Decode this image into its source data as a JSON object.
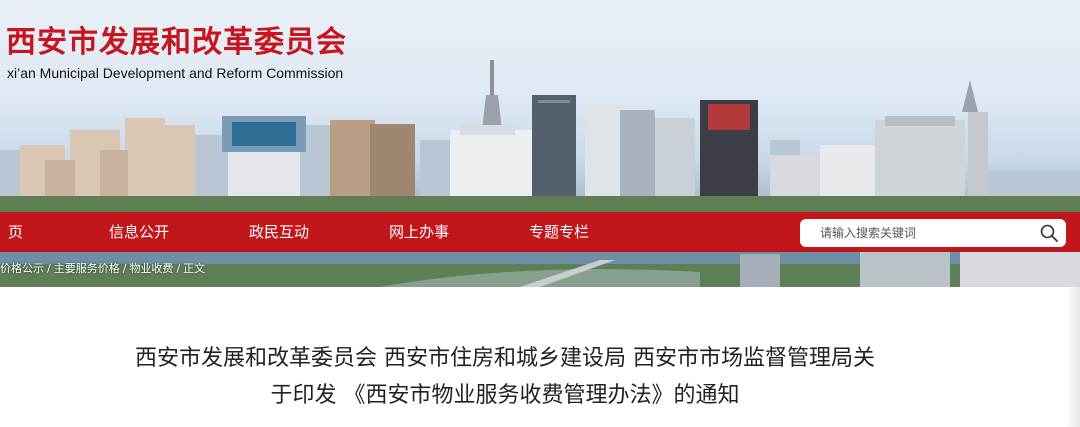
{
  "header": {
    "title": "西安市发展和改革委员会",
    "subtitle": "xi’an Municipal Development and Reform Commission"
  },
  "nav": {
    "items": [
      {
        "label": "页"
      },
      {
        "label": "信息公开"
      },
      {
        "label": "政民互动"
      },
      {
        "label": "网上办事"
      },
      {
        "label": "专题专栏"
      }
    ]
  },
  "search": {
    "placeholder": "请输入搜索关键词"
  },
  "breadcrumb": {
    "items": [
      "价格公示",
      "主要服务价格",
      "物业收费",
      "正文"
    ],
    "separator": "/"
  },
  "article": {
    "title_line1": "西安市发展和改革委员会 西安市住房和城乡建设局 西安市市场监督管理局关",
    "title_line2": "于印发 《西安市物业服务收费管理办法》的通知"
  },
  "colors": {
    "brand_red": "#c1161c",
    "title_red": "#c8151d"
  },
  "icons": {
    "search": "search-icon"
  }
}
